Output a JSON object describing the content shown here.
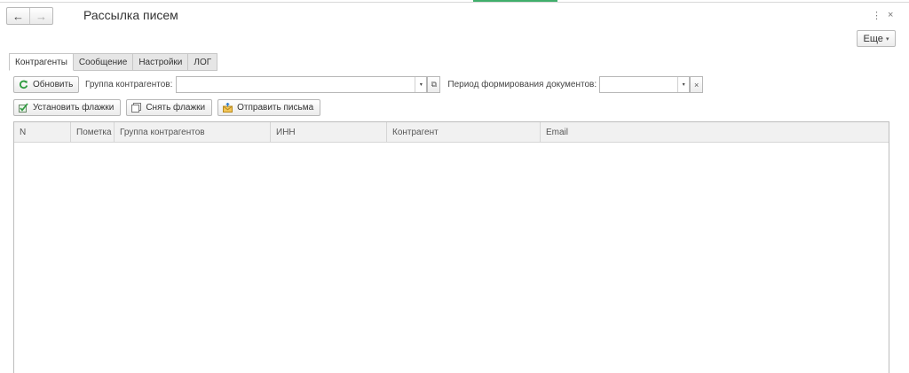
{
  "window": {
    "title": "Рассылка писем",
    "nav_back": "←",
    "nav_forward": "→",
    "menu_glyph": "⋮",
    "close_glyph": "×",
    "more_button": "Еще",
    "more_caret": "▾"
  },
  "tabs": [
    {
      "label": "Контрагенты",
      "active": true
    },
    {
      "label": "Сообщение",
      "active": false
    },
    {
      "label": "Настройки",
      "active": false
    },
    {
      "label": "ЛОГ",
      "active": false
    }
  ],
  "toolbar": {
    "refresh_label": "Обновить",
    "group_label": "Группа контрагентов:",
    "group_value": "",
    "period_label": "Период формирования документов:",
    "period_value": "",
    "dropdown_glyph": "▾",
    "open_glyph": "⧉",
    "clear_glyph": "×"
  },
  "actions": {
    "set_flags": "Установить флажки",
    "clear_flags": "Снять флажки",
    "send_emails": "Отправить письма"
  },
  "table": {
    "columns": [
      "N",
      "Пометка",
      "Группа контрагентов",
      "ИНН",
      "Контрагент",
      "Email"
    ],
    "rows": []
  },
  "icons": {
    "refresh": "refresh-icon",
    "set_flags": "checkbox-checked-icon",
    "clear_flags": "checkbox-unchecked-icon",
    "send": "envelope-send-icon"
  },
  "colors": {
    "refresh_icon": "#2e9b3f",
    "accent_green": "#3fae6b"
  }
}
